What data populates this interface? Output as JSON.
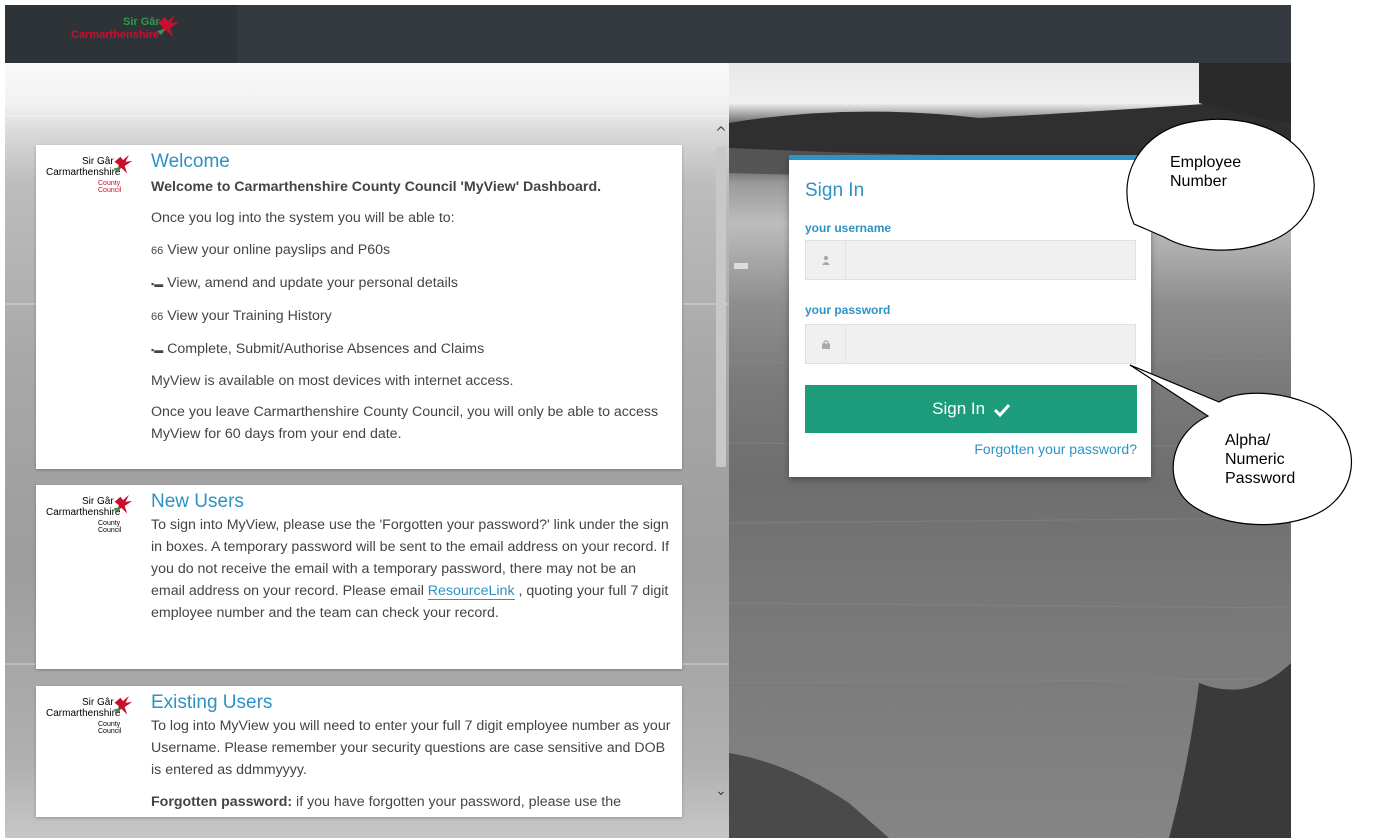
{
  "header": {
    "logo_top": "Sir Gâr",
    "logo_main": "Carmarthenshire"
  },
  "welcome": {
    "logo_top": "Sir Gâr",
    "logo_main": "Carmarthenshire",
    "logo_sub": "County Council",
    "title": "Welcome",
    "intro": "Welcome to Carmarthenshire County Council 'MyView' Dashboard.",
    "line1": "Once you log into the system you will be able to:",
    "items": [
      {
        "bullet": "66",
        "text": "View your online payslips and P60s"
      },
      {
        "bullet": "▪▬",
        "text": "View, amend and update your personal details"
      },
      {
        "bullet": "66",
        "text": "View your Training History"
      },
      {
        "bullet": "▪▬",
        "text": "Complete, Submit/Authorise Absences and Claims"
      }
    ],
    "line2": "MyView is available on most devices with internet access.",
    "line3": "Once you leave Carmarthenshire County Council, you will only be able to access MyView for 60 days from your end date."
  },
  "new_users": {
    "logo_top": "Sir Gâr",
    "logo_main": "Carmarthenshire",
    "logo_sub": "County Council",
    "title": "New Users",
    "text_before": "To sign into MyView, please use the 'Forgotten your password?' link under the sign in boxes. A temporary password will be sent to the email address on your record. If you do not receive the email with a temporary password, there may not be an email address on your record. Please email ",
    "link": "ResourceLink",
    "text_after": " , quoting your full 7 digit employee number and the team can check your record."
  },
  "existing_users": {
    "logo_top": "Sir Gâr",
    "logo_main": "Carmarthenshire",
    "logo_sub": "County Council",
    "title": "Existing Users",
    "text": "To log into MyView you will need to enter your full 7 digit employee number as your Username. Please remember your security questions are case sensitive and DOB is entered as ddmmyyyy.",
    "bold": "Forgotten password:",
    "text2": " if you have forgotten your password, please use the"
  },
  "signin": {
    "title": "Sign In",
    "username_label": "your username",
    "username_value": "",
    "username_icon": "user-icon",
    "password_label": "your password",
    "password_value": "",
    "password_icon": "lock-icon",
    "button_label": "Sign In",
    "forgot_link": "Forgotten your password?"
  },
  "callouts": {
    "employee": [
      "Employee",
      "Number"
    ],
    "password": [
      "Alpha/",
      "Numeric",
      "Password"
    ]
  },
  "colors": {
    "accent": "#2d92c4",
    "button": "#1d9c7c",
    "header": "#343a40"
  }
}
